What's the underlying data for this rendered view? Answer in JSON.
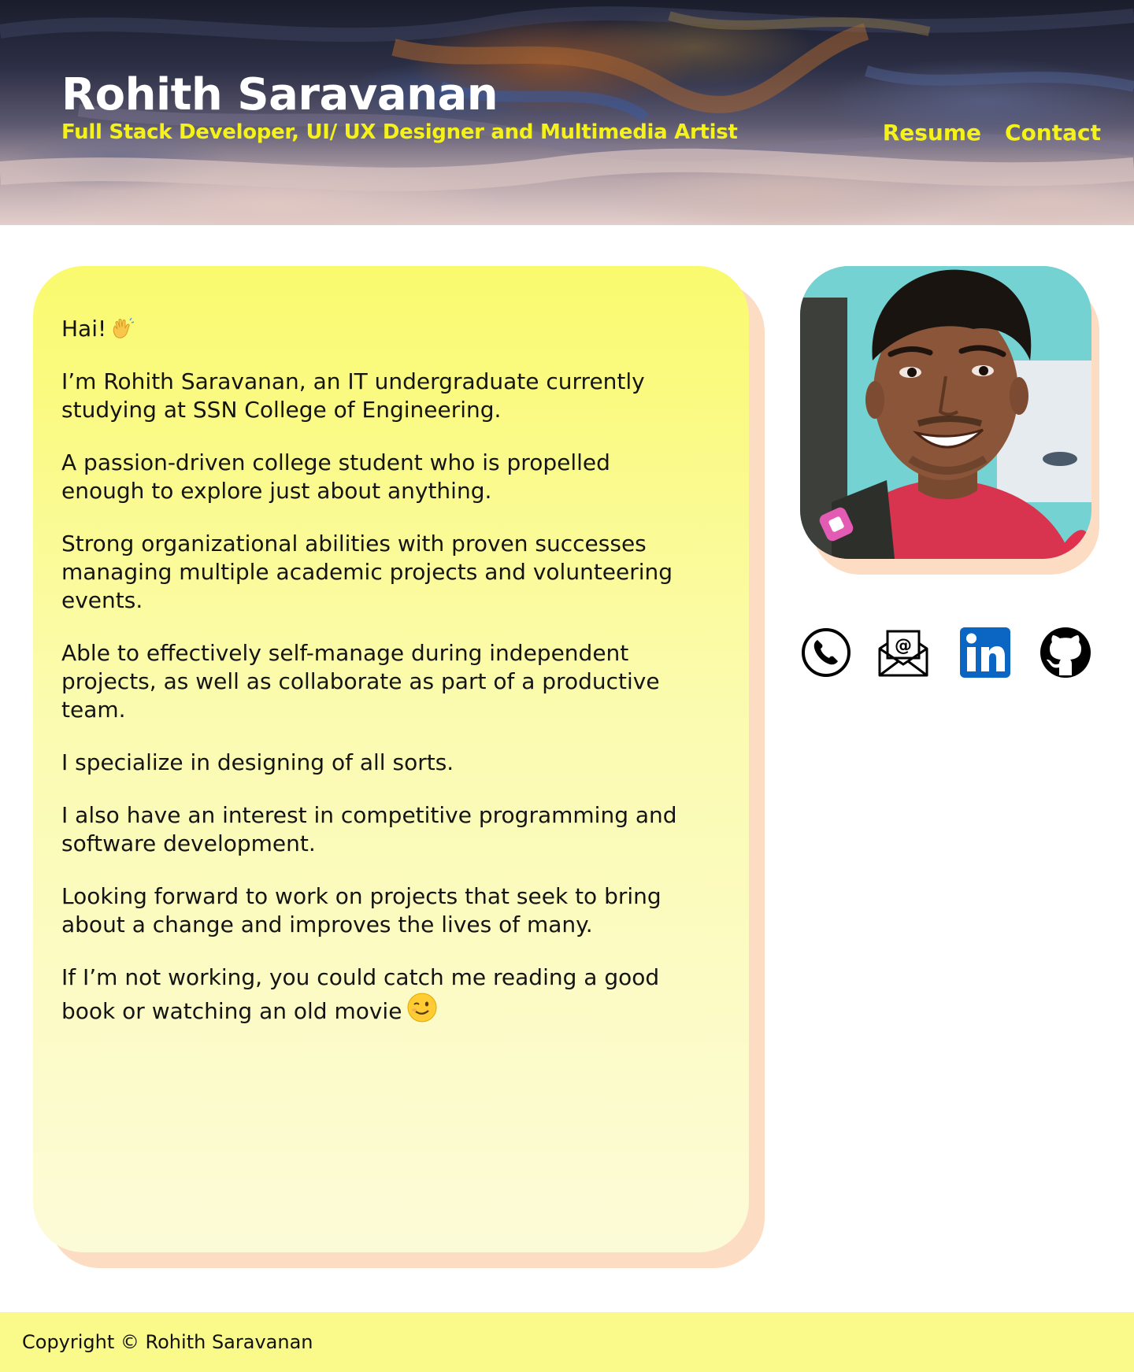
{
  "header": {
    "title": "Rohith Saravanan",
    "subtitle": "Full Stack Developer, UI/ UX Designer and Multimedia Artist",
    "nav": [
      {
        "label": "Resume"
      },
      {
        "label": "Contact"
      }
    ]
  },
  "about": {
    "paragraphs": [
      "Hai!",
      "I’m Rohith Saravanan, an IT undergraduate currently studying at SSN College of Engineering.",
      "A passion-driven college student who is propelled enough to explore just about anything.",
      "Strong organizational abilities with proven successes managing multiple academic projects and volunteering events.",
      "Able to effectively self-manage during independent projects, as well as collaborate as part of a productive team.",
      "I specialize in designing of all sorts.",
      "I also have an interest in competitive programming and software development.",
      "Looking forward to work on projects that seek to bring about a change and improves the lives of many.",
      "If I’m not working, you could catch me reading a good book or watching an old movie"
    ],
    "emojis": {
      "greeting": "waving-hand-emoji",
      "closing": "winking-face-emoji"
    }
  },
  "socials": [
    {
      "icon": "phone-icon"
    },
    {
      "icon": "email-icon"
    },
    {
      "icon": "linkedin-icon",
      "color": "#0a66c2"
    },
    {
      "icon": "github-icon"
    }
  ],
  "footer": {
    "copyright": "Copyright © Rohith Saravanan"
  },
  "colors": {
    "accent_yellow": "#f5f21a",
    "card_yellow": "#fafa6e",
    "card_shadow": "#fcdcc2",
    "footer_bg": "#fafa8a"
  }
}
